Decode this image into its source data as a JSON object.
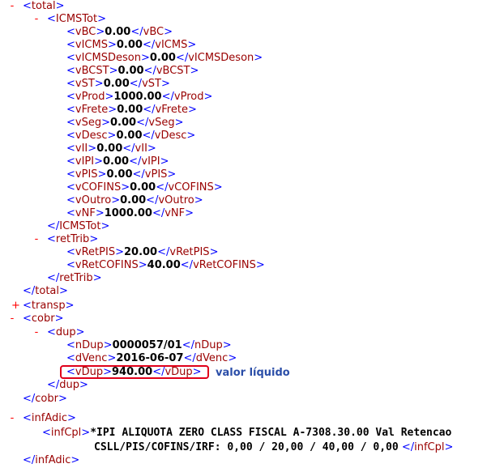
{
  "symbols": {
    "open_lt": "<",
    "close_lt": "</",
    "gt": ">",
    "minus": "-",
    "plus": "+"
  },
  "nodes": {
    "total": "total",
    "icmstot": "ICMSTot",
    "vBC": {
      "tag": "vBC",
      "value": "0.00"
    },
    "vICMS": {
      "tag": "vICMS",
      "value": "0.00"
    },
    "vICMSDeson": {
      "tag": "vICMSDeson",
      "value": "0.00"
    },
    "vBCST": {
      "tag": "vBCST",
      "value": "0.00"
    },
    "vST": {
      "tag": "vST",
      "value": "0.00"
    },
    "vProd": {
      "tag": "vProd",
      "value": "1000.00"
    },
    "vFrete": {
      "tag": "vFrete",
      "value": "0.00"
    },
    "vSeg": {
      "tag": "vSeg",
      "value": "0.00"
    },
    "vDesc": {
      "tag": "vDesc",
      "value": "0.00"
    },
    "vII": {
      "tag": "vII",
      "value": "0.00"
    },
    "vIPI": {
      "tag": "vIPI",
      "value": "0.00"
    },
    "vPIS": {
      "tag": "vPIS",
      "value": "0.00"
    },
    "vCOFINS": {
      "tag": "vCOFINS",
      "value": "0.00"
    },
    "vOutro": {
      "tag": "vOutro",
      "value": "0.00"
    },
    "vNF": {
      "tag": "vNF",
      "value": "1000.00"
    },
    "rettrib": "retTrib",
    "vRetPIS": {
      "tag": "vRetPIS",
      "value": "20.00"
    },
    "vRetCOFINS": {
      "tag": "vRetCOFINS",
      "value": "40.00"
    },
    "transp": "transp",
    "cobr": "cobr",
    "dup": "dup",
    "nDup": {
      "tag": "nDup",
      "value": "0000057/01"
    },
    "dVenc": {
      "tag": "dVenc",
      "value": "2016-06-07"
    },
    "vDup": {
      "tag": "vDup",
      "value": "940.00"
    },
    "infadic": "infAdic",
    "infCpl": {
      "tag": "infCpl",
      "line1": "*IPI ALIQUOTA ZERO CLASS FISCAL A-7308.30.00 Val Retencao",
      "line2": "CSLL/PIS/COFINS/IRF: 0,00 / 20,00 / 40,00 / 0,00"
    }
  },
  "annotation": {
    "text": "valor líquido",
    "color": "#2b4ea8"
  },
  "colors": {
    "tag": "#990000",
    "bracket": "#0000ff",
    "toggle": "#ff0000",
    "highlight": "#e0001a"
  }
}
